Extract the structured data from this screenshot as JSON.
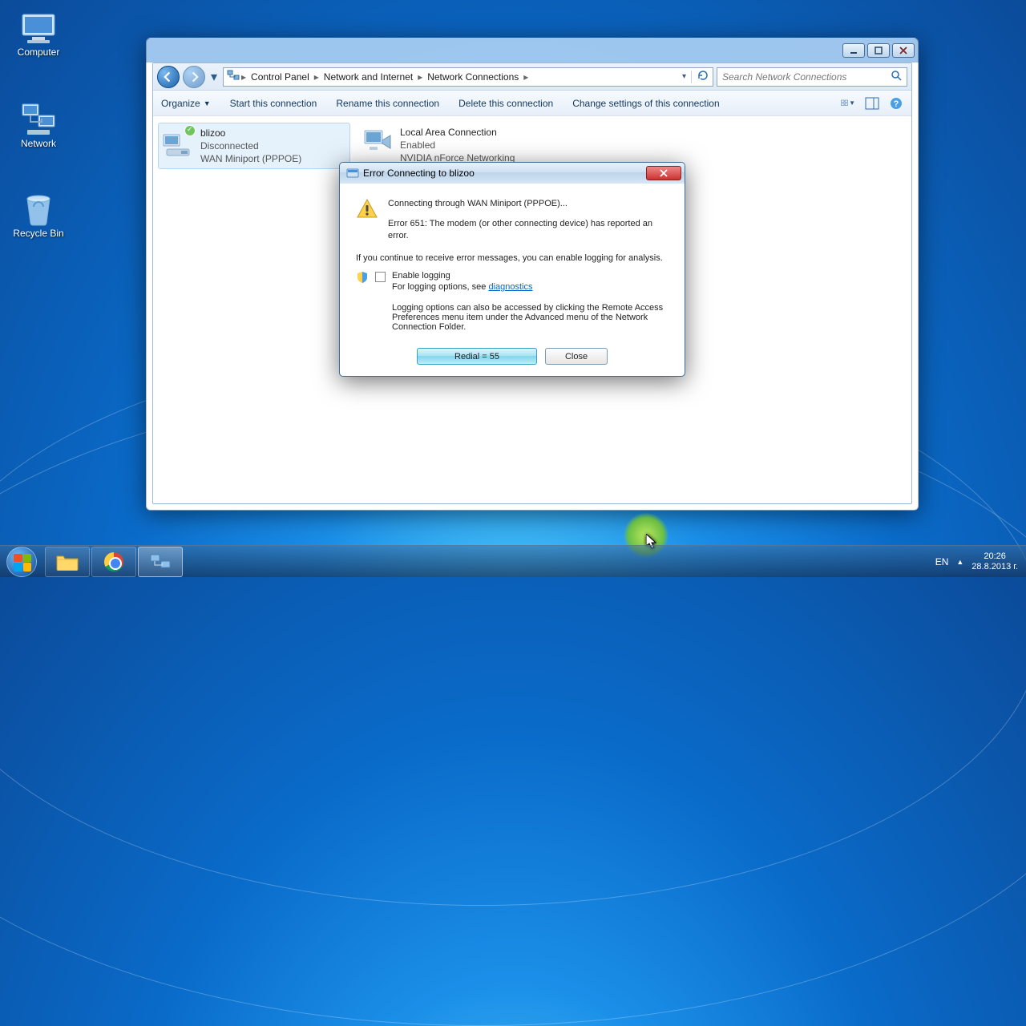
{
  "desktop": {
    "computer": "Computer",
    "network": "Network",
    "recycle": "Recycle Bin"
  },
  "window": {
    "breadcrumb": {
      "b1": "Control Panel",
      "b2": "Network and Internet",
      "b3": "Network Connections"
    },
    "search_placeholder": "Search Network Connections",
    "toolbar": {
      "organize": "Organize",
      "start": "Start this connection",
      "rename": "Rename this connection",
      "delete": "Delete this connection",
      "change": "Change settings of this connection"
    },
    "conn1": {
      "name": "blizoo",
      "status": "Disconnected",
      "device": "WAN Miniport (PPPOE)"
    },
    "conn2": {
      "name": "Local Area Connection",
      "status": "Enabled",
      "device": "NVIDIA nForce Networking Contr..."
    }
  },
  "dialog": {
    "title": "Error Connecting to blizoo",
    "line1": "Connecting through WAN Miniport (PPPOE)...",
    "line2": "Error 651: The modem (or other connecting device) has reported an error.",
    "line3": "If you continue to receive error messages, you can enable logging for analysis.",
    "enable": "Enable logging",
    "logopts_a": "For logging options, see ",
    "logopts_link": "diagnostics",
    "line4": "Logging options can also be accessed by clicking the Remote Access Preferences menu item under the Advanced menu of the Network Connection Folder.",
    "redial": "Redial = 55",
    "close": "Close"
  },
  "taskbar": {
    "lang": "EN",
    "time": "20:26",
    "date": "28.8.2013 г."
  }
}
